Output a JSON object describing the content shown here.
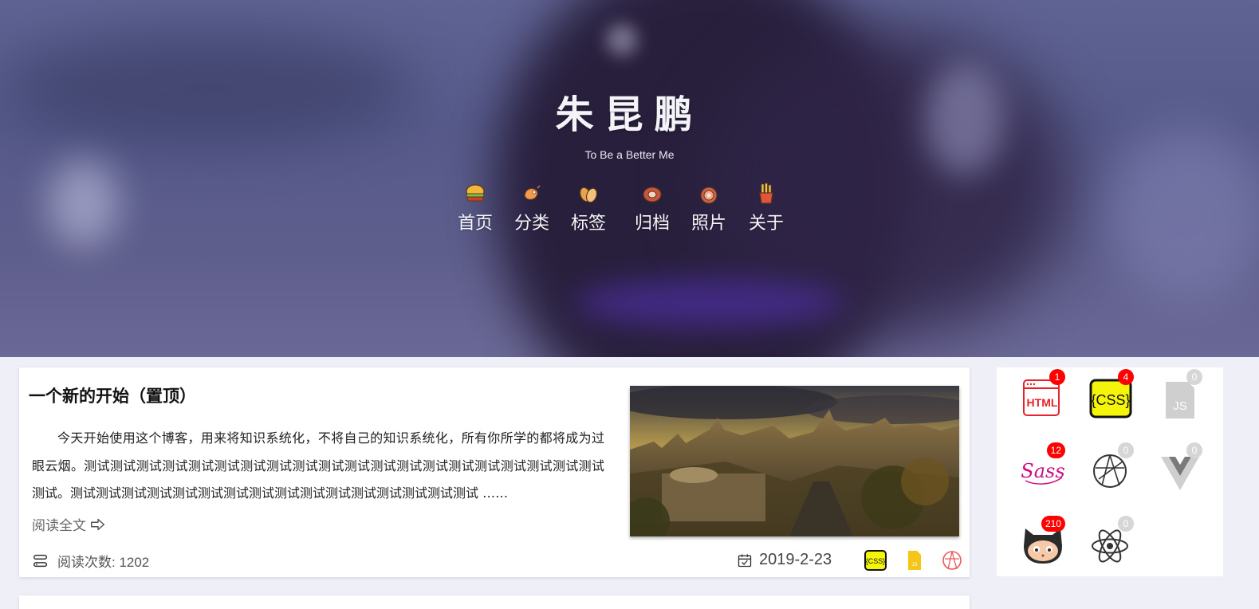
{
  "hero": {
    "title": "朱昆鹏",
    "subtitle": "To Be a Better Me"
  },
  "nav": {
    "items": [
      {
        "label": "首页",
        "icon": "burger-icon"
      },
      {
        "label": "分类",
        "icon": "shrimp-icon"
      },
      {
        "label": "标签",
        "icon": "nuts-icon"
      },
      {
        "label": "归档",
        "icon": "meat-icon"
      },
      {
        "label": "照片",
        "icon": "onion-icon"
      },
      {
        "label": "关于",
        "icon": "fries-icon"
      }
    ]
  },
  "post": {
    "title": "一个新的开始（置顶）",
    "excerpt": "今天开始使用这个博客，用来将知识系统化，不将自己的知识系统化，所有你所学的都将成为过眼云烟。测试测试测试测试测试测试测试测试测试测试测试测试测试测试测试测试测试测试测试测试测试。测试测试测试测试测试测试测试测试测试测试测试测试测试测试测试测试 ……",
    "read_more": "阅读全文",
    "views_label": "阅读次数: 1202",
    "date": "2019-2-23",
    "tags": [
      "css-icon",
      "js-icon",
      "canvas-icon"
    ]
  },
  "sidebar": {
    "skills": [
      {
        "name": "html-icon",
        "count": "1"
      },
      {
        "name": "css-icon",
        "count": "4"
      },
      {
        "name": "js-icon",
        "count": "0"
      },
      {
        "name": "sass-icon",
        "count": "12"
      },
      {
        "name": "canvas-icon",
        "count": "0"
      },
      {
        "name": "vue-icon",
        "count": "0"
      },
      {
        "name": "github-icon",
        "count": "210"
      },
      {
        "name": "react-icon",
        "count": "0"
      }
    ]
  },
  "colors": {
    "accent_red": "#ff0000",
    "css_yellow": "#f5f50a",
    "html_red": "#e8222b",
    "sass_pink": "#cd0d87"
  }
}
